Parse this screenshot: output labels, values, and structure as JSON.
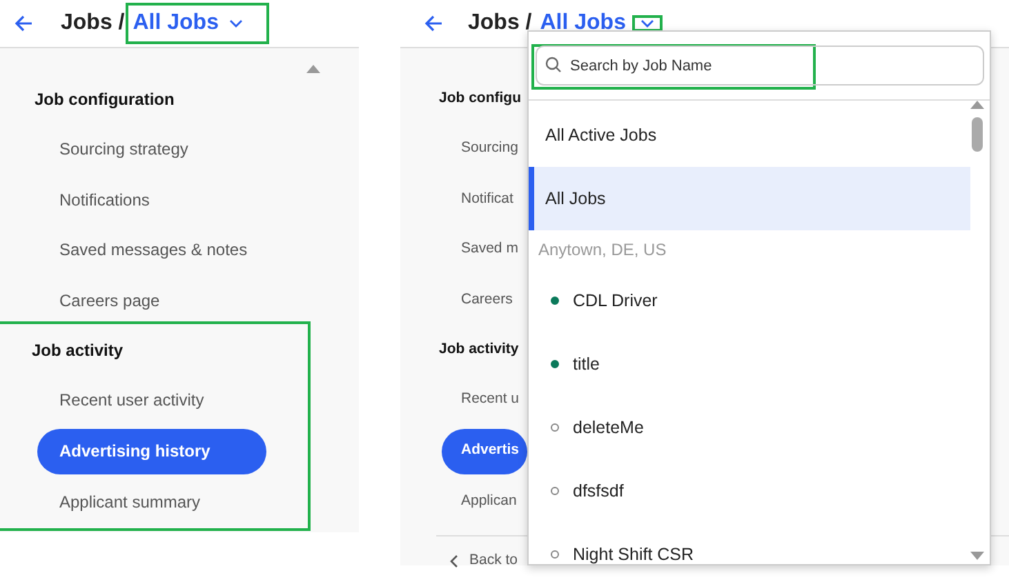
{
  "left_panel": {
    "header": {
      "parent": "Jobs /",
      "current": "All Jobs",
      "highlighted": true
    },
    "sidebar": {
      "sections": [
        {
          "title": "Job configuration",
          "items": [
            {
              "label": "Sourcing strategy",
              "selected": false
            },
            {
              "label": "Notifications",
              "selected": false
            },
            {
              "label": "Saved messages & notes",
              "selected": false
            },
            {
              "label": "Careers page",
              "selected": false
            }
          ]
        },
        {
          "title": "Job activity",
          "highlighted": true,
          "items": [
            {
              "label": "Recent user activity",
              "selected": false
            },
            {
              "label": "Advertising history",
              "selected": true
            },
            {
              "label": "Applicant summary",
              "selected": false
            }
          ]
        }
      ]
    }
  },
  "right_panel": {
    "header": {
      "parent": "Jobs /",
      "current": "All Jobs",
      "caret_highlighted": true
    },
    "sidebar": {
      "sections": [
        {
          "title": "Job configu",
          "items": [
            {
              "label": "Sourcing",
              "selected": false
            },
            {
              "label": "Notificat",
              "selected": false
            },
            {
              "label": "Saved m",
              "selected": false
            },
            {
              "label": "Careers",
              "selected": false
            }
          ]
        },
        {
          "title": "Job activity",
          "items": [
            {
              "label": "Recent u",
              "selected": false
            },
            {
              "label": "Advertis",
              "selected": true
            },
            {
              "label": "Applican",
              "selected": false
            }
          ]
        }
      ],
      "back_link": "Back to"
    },
    "dropdown": {
      "search": {
        "placeholder": "Search by Job Name",
        "highlighted": true
      },
      "options": [
        {
          "kind": "option",
          "label": "All Active Jobs",
          "selected": false
        },
        {
          "kind": "option",
          "label": "All Jobs",
          "selected": true
        },
        {
          "kind": "group",
          "label": "Anytown, DE, US"
        },
        {
          "kind": "job",
          "label": "CDL Driver",
          "active": true,
          "selected": false
        },
        {
          "kind": "job",
          "label": "title",
          "active": true,
          "selected": false
        },
        {
          "kind": "job",
          "label": "deleteMe",
          "active": false,
          "selected": false
        },
        {
          "kind": "job",
          "label": "dfsfsdf",
          "active": false,
          "selected": false
        },
        {
          "kind": "job",
          "label": "Night Shift CSR",
          "active": false,
          "selected": false
        }
      ]
    }
  }
}
